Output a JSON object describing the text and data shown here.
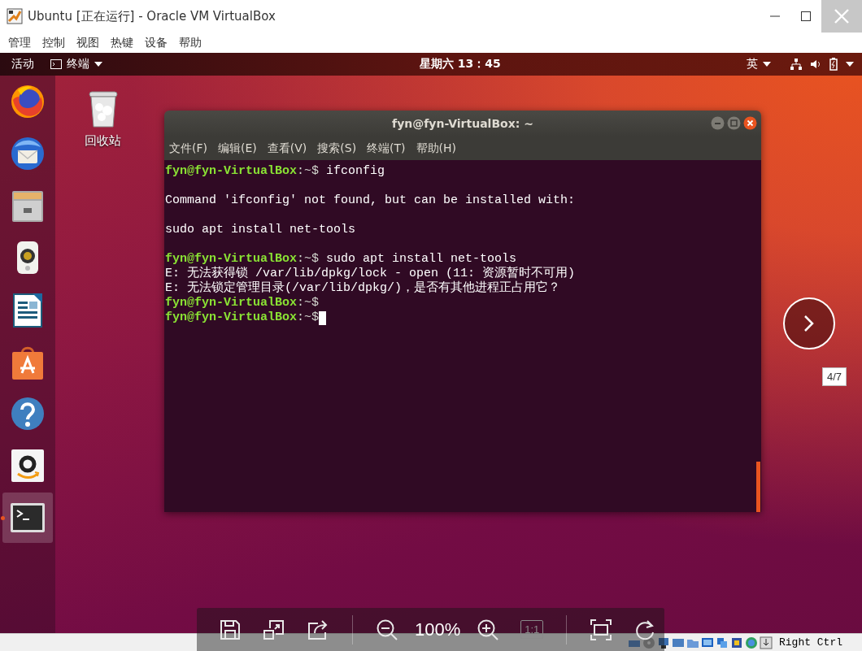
{
  "window": {
    "title": "Ubuntu [正在运行] - Oracle VM VirtualBox"
  },
  "menu": [
    "管理",
    "控制",
    "视图",
    "热键",
    "设备",
    "帮助"
  ],
  "top_bar": {
    "activities": "活动",
    "app_menu": "终端",
    "clock": "星期六 13：45",
    "input_method": "英"
  },
  "dock": [
    {
      "kind": "browser",
      "running": false
    },
    {
      "kind": "mail",
      "running": false
    },
    {
      "kind": "files",
      "running": false
    },
    {
      "kind": "music",
      "running": false
    },
    {
      "kind": "writer",
      "running": false
    },
    {
      "kind": "software",
      "running": false
    },
    {
      "kind": "help",
      "running": false
    },
    {
      "kind": "shop",
      "running": false
    },
    {
      "kind": "terminal",
      "running": true
    }
  ],
  "desktop_icons": [
    {
      "label": "回收站"
    }
  ],
  "terminal": {
    "title": "fyn@fyn-VirtualBox: ~",
    "menu": [
      "文件(F)",
      "编辑(E)",
      "查看(V)",
      "搜索(S)",
      "终端(T)",
      "帮助(H)"
    ],
    "lines": [
      {
        "kind": "prompt",
        "user": "fyn@fyn-VirtualBox",
        "path": ":~$",
        "command": "ifconfig",
        "gap_before": false,
        "cursor": false
      },
      {
        "kind": "output",
        "text": "Command 'ifconfig' not found, but can be installed with:",
        "gap_before": true
      },
      {
        "kind": "output",
        "text": "sudo apt install net-tools",
        "gap_before": true
      },
      {
        "kind": "prompt",
        "user": "fyn@fyn-VirtualBox",
        "path": ":~$",
        "command": "sudo apt install net-tools",
        "gap_before": true,
        "cursor": false
      },
      {
        "kind": "output",
        "text": "E: 无法获得锁 /var/lib/dpkg/lock - open (11: 资源暂时不可用)",
        "gap_before": false
      },
      {
        "kind": "output",
        "text": "E: 无法锁定管理目录(/var/lib/dpkg/)，是否有其他进程正占用它？",
        "gap_before": false
      },
      {
        "kind": "prompt",
        "user": "fyn@fyn-VirtualBox",
        "path": ":~$",
        "gap_before": false,
        "cursor": false
      },
      {
        "kind": "prompt",
        "user": "fyn@fyn-VirtualBox",
        "path": ":~$",
        "gap_before": false,
        "cursor": true
      }
    ]
  },
  "status_bar": {
    "host_key": "Right Ctrl"
  },
  "viewer": {
    "zoom": "100%",
    "one_to_one": {
      "label": "1:1",
      "disabled": true
    },
    "counter": "4/7"
  }
}
